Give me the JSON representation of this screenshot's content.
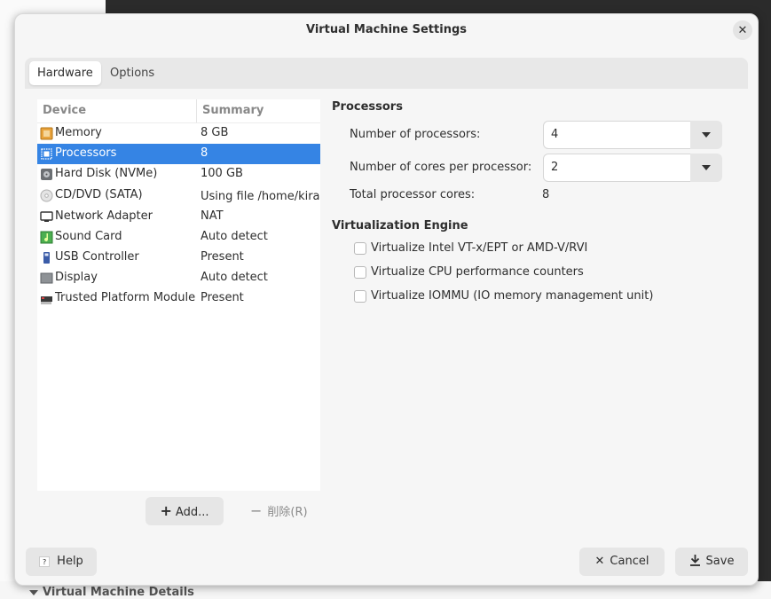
{
  "background": {
    "details_label": "Virtual Machine Details"
  },
  "dialog": {
    "title": "Virtual Machine Settings",
    "close_glyph": "✕"
  },
  "tabs": [
    {
      "label": "Hardware",
      "active": true
    },
    {
      "label": "Options",
      "active": false
    }
  ],
  "device_list": {
    "columns": [
      "Device",
      "Summary"
    ],
    "rows": [
      {
        "name": "Memory",
        "summary": "8 GB",
        "icon": "memory-icon"
      },
      {
        "name": "Processors",
        "summary": "8",
        "icon": "processor-icon",
        "selected": true
      },
      {
        "name": "Hard Disk (NVMe)",
        "summary": "100 GB",
        "icon": "hard-disk-icon"
      },
      {
        "name": "CD/DVD (SATA)",
        "summary": "Using file /home/kiray",
        "icon": "cd-dvd-icon"
      },
      {
        "name": "Network Adapter",
        "summary": "NAT",
        "icon": "network-adapter-icon"
      },
      {
        "name": "Sound Card",
        "summary": "Auto detect",
        "icon": "sound-card-icon"
      },
      {
        "name": "USB Controller",
        "summary": "Present",
        "icon": "usb-icon"
      },
      {
        "name": "Display",
        "summary": "Auto detect",
        "icon": "display-icon"
      },
      {
        "name": "Trusted Platform Module",
        "summary": "Present",
        "icon": "tpm-icon"
      }
    ],
    "add_label": "Add...",
    "remove_label": "削除(R)"
  },
  "processors": {
    "section_title": "Processors",
    "num_processors_label": "Number of processors:",
    "num_processors_value": "4",
    "cores_label": "Number of cores per processor:",
    "cores_value": "2",
    "total_label": "Total processor cores:",
    "total_value": "8"
  },
  "virtualization": {
    "section_title": "Virtualization Engine",
    "options": [
      {
        "label": "Virtualize Intel VT-x/EPT or AMD-V/RVI",
        "checked": false
      },
      {
        "label": "Virtualize CPU performance counters",
        "checked": false
      },
      {
        "label": "Virtualize IOMMU (IO memory management unit)",
        "checked": false
      }
    ]
  },
  "footer": {
    "help_label": "Help",
    "help_glyph": "?",
    "cancel_label": "Cancel",
    "save_label": "Save"
  },
  "colors": {
    "selection": "#3584e4",
    "dialog_bg": "#f6f6f6"
  }
}
